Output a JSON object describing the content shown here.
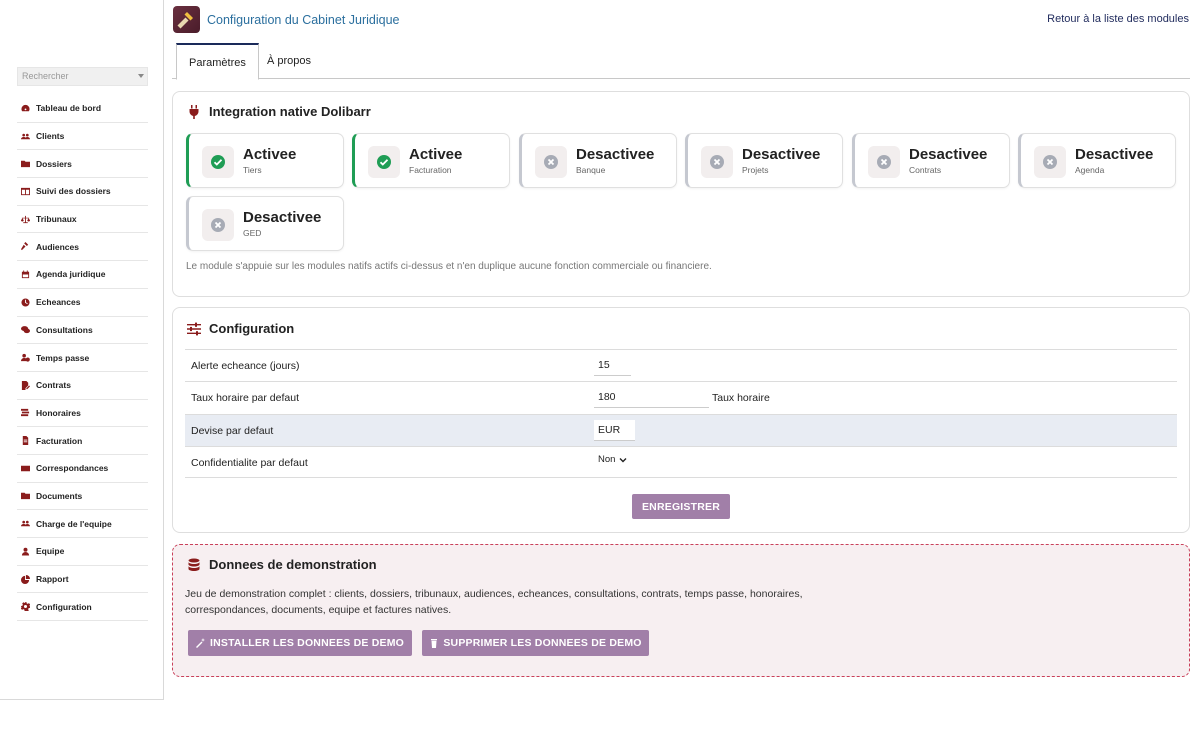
{
  "header": {
    "title": "Configuration du Cabinet Juridique",
    "back_link": "Retour à la liste des modules"
  },
  "sidebar": {
    "search_placeholder": "Rechercher",
    "items": [
      {
        "label": "Tableau de bord",
        "icon": "dashboard-icon"
      },
      {
        "label": "Clients",
        "icon": "users-icon"
      },
      {
        "label": "Dossiers",
        "icon": "folder-icon"
      },
      {
        "label": "Suivi des dossiers",
        "icon": "columns-icon"
      },
      {
        "label": "Tribunaux",
        "icon": "scale-icon"
      },
      {
        "label": "Audiences",
        "icon": "gavel-icon"
      },
      {
        "label": "Agenda juridique",
        "icon": "calendar-icon"
      },
      {
        "label": "Echeances",
        "icon": "clock-icon"
      },
      {
        "label": "Consultations",
        "icon": "comments-icon"
      },
      {
        "label": "Temps passe",
        "icon": "user-clock-icon"
      },
      {
        "label": "Contrats",
        "icon": "file-signature-icon"
      },
      {
        "label": "Honoraires",
        "icon": "money-stack-icon"
      },
      {
        "label": "Facturation",
        "icon": "invoice-icon"
      },
      {
        "label": "Correspondances",
        "icon": "envelope-icon"
      },
      {
        "label": "Documents",
        "icon": "folder-icon"
      },
      {
        "label": "Charge de l'equipe",
        "icon": "team-icon"
      },
      {
        "label": "Equipe",
        "icon": "user-icon"
      },
      {
        "label": "Rapport",
        "icon": "pie-chart-icon"
      },
      {
        "label": "Configuration",
        "icon": "gear-icon"
      }
    ]
  },
  "tabs": [
    {
      "label": "Paramètres",
      "active": true
    },
    {
      "label": "À propos",
      "active": false
    }
  ],
  "integration": {
    "title": "Integration native Dolibarr",
    "tiles": [
      {
        "status": "Activee",
        "module": "Tiers",
        "enabled": true
      },
      {
        "status": "Activee",
        "module": "Facturation",
        "enabled": true
      },
      {
        "status": "Desactivee",
        "module": "Banque",
        "enabled": false
      },
      {
        "status": "Desactivee",
        "module": "Projets",
        "enabled": false
      },
      {
        "status": "Desactivee",
        "module": "Contrats",
        "enabled": false
      },
      {
        "status": "Desactivee",
        "module": "Agenda",
        "enabled": false
      },
      {
        "status": "Desactivee",
        "module": "GED",
        "enabled": false
      }
    ],
    "note": "Le module s'appuie sur les modules natifs actifs ci-dessus et n'en duplique aucune fonction commerciale ou financiere."
  },
  "configuration": {
    "title": "Configuration",
    "rows": [
      {
        "label": "Alerte echeance (jours)",
        "value": "15"
      },
      {
        "label": "Taux horaire par defaut",
        "value": "180",
        "unit": "Taux horaire"
      },
      {
        "label": "Devise par defaut",
        "value": "EUR"
      },
      {
        "label": "Confidentialite par defaut",
        "value": "Non"
      }
    ],
    "save_label": "ENREGISTRER"
  },
  "demo": {
    "title": "Donnees de demonstration",
    "text": "Jeu de demonstration complet : clients, dossiers, tribunaux, audiences, echeances, consultations, contrats, temps passe, honoraires, correspondances, documents, equipe et factures natives.",
    "install_label": "INSTALLER LES DONNEES DE DEMO",
    "delete_label": "SUPPRIMER LES DONNEES DE DEMO"
  },
  "colors": {
    "accent_red": "#8a1c1c",
    "button": "#a17fa8",
    "active_green": "#1f9d55",
    "inactive_gray": "#c5c8d0",
    "title_blue": "#2b6f9e"
  }
}
